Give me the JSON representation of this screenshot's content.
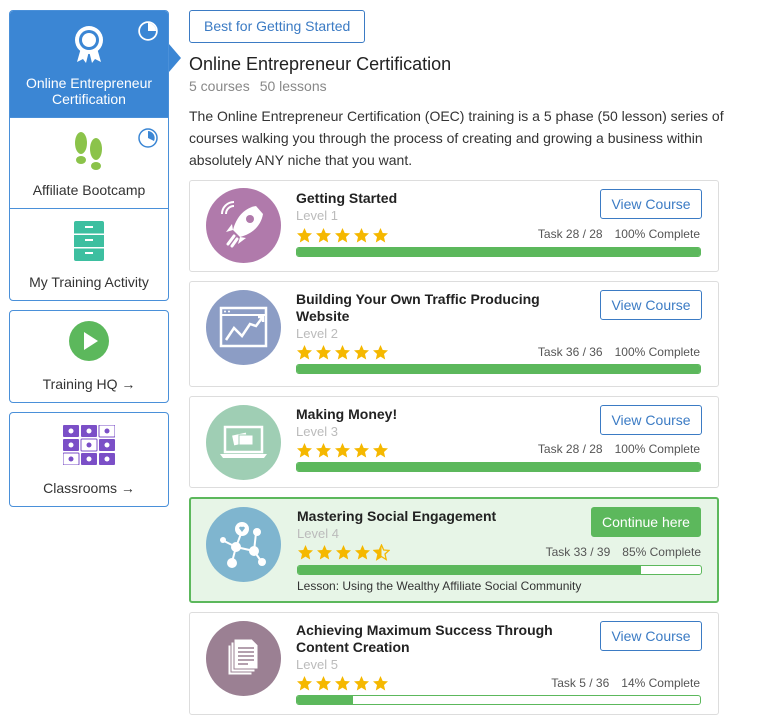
{
  "sidebar": {
    "paths": [
      {
        "label": "Online Entrepreneur Certification",
        "icon": "award-ribbon-icon",
        "progress": 0.75
      },
      {
        "label": "Affiliate Bootcamp",
        "icon": "footprints-icon",
        "progress": 0.3
      },
      {
        "label": "My Training Activity",
        "icon": "file-cabinet-icon"
      }
    ],
    "links": [
      {
        "label": "Training HQ →",
        "icon": "play-circle-icon"
      },
      {
        "label": "Classrooms →",
        "icon": "classroom-grid-icon"
      }
    ]
  },
  "main": {
    "tag": "Best for Getting Started",
    "title": "Online Entrepreneur Certification",
    "courses": "5 courses",
    "lessons": "50 lessons",
    "description": "The Online Entrepreneur Certification (OEC) training is a 5 phase (50 lesson) series of courses walking you through the process of creating and growing a business within absolutely ANY niche that you want."
  },
  "colors": {
    "accent": "#3b86d4",
    "progress": "#5cb85c",
    "star": "#f5b800"
  },
  "courses": [
    {
      "title": "Getting Started",
      "level": "Level 1",
      "icon": "rocket-icon",
      "task": "Task 28 / 28",
      "complete": "100% Complete",
      "progress": 1.0,
      "stars": 5,
      "button": "View Course"
    },
    {
      "title": "Building Your Own Traffic Producing Website",
      "level": "Level 2",
      "icon": "website-chart-icon",
      "task": "Task 36 / 36",
      "complete": "100% Complete",
      "progress": 1.0,
      "stars": 5,
      "button": "View Course"
    },
    {
      "title": "Making Money!",
      "level": "Level 3",
      "icon": "laptop-payment-icon",
      "task": "Task 28 / 28",
      "complete": "100% Complete",
      "progress": 1.0,
      "stars": 5,
      "button": "View Course"
    },
    {
      "title": "Mastering Social Engagement",
      "level": "Level 4",
      "icon": "social-network-icon",
      "task": "Task 33 / 39",
      "complete": "85% Complete",
      "progress": 0.85,
      "stars": 4.5,
      "button": "Continue here",
      "lesson": "Lesson: Using the Wealthy Affiliate Social Community"
    },
    {
      "title": "Achieving Maximum Success Through Content Creation",
      "level": "Level 5",
      "icon": "documents-icon",
      "task": "Task 5 / 36",
      "complete": "14% Complete",
      "progress": 0.14,
      "stars": 5,
      "button": "View Course"
    }
  ]
}
